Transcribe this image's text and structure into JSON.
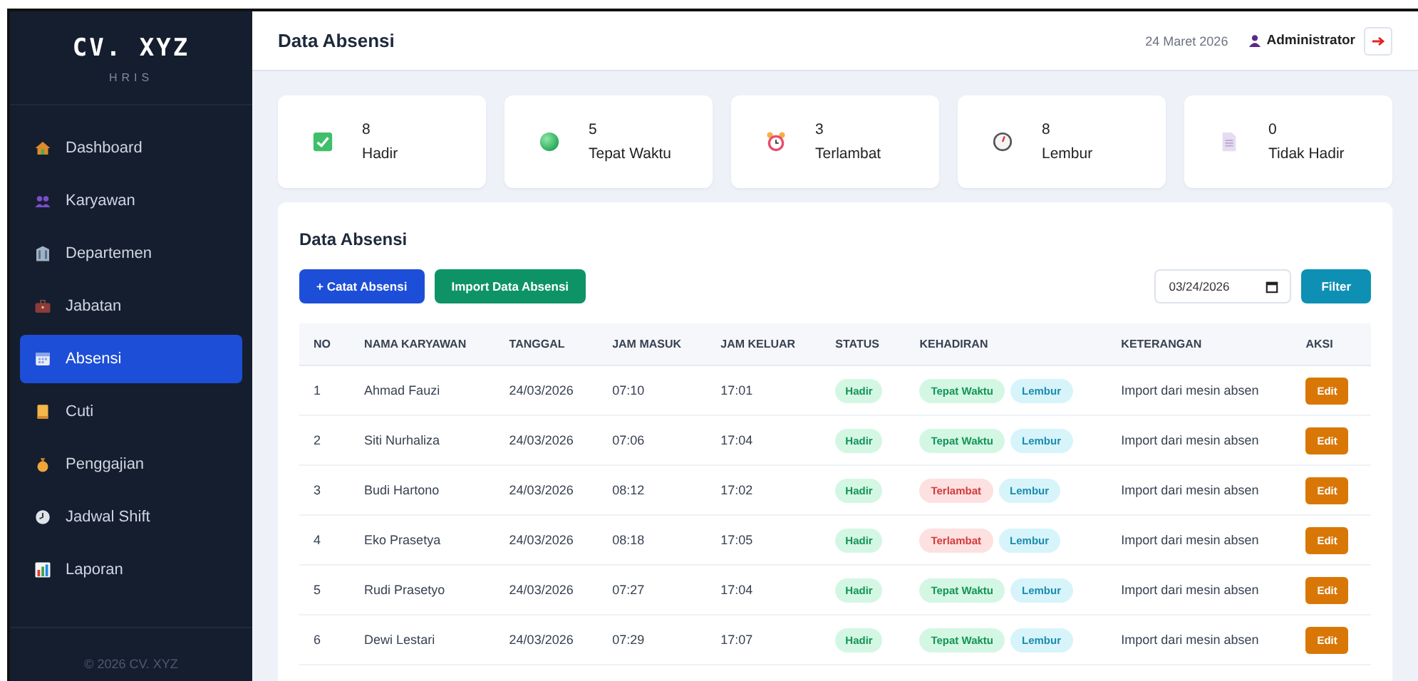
{
  "sidebar": {
    "brand": "CV. XYZ",
    "subtitle": "HRIS",
    "items": [
      {
        "label": "Dashboard",
        "kind": "house",
        "selected": false
      },
      {
        "label": "Karyawan",
        "kind": "people",
        "selected": false
      },
      {
        "label": "Departemen",
        "kind": "building",
        "selected": false
      },
      {
        "label": "Jabatan",
        "kind": "briefcase",
        "selected": false
      },
      {
        "label": "Absensi",
        "kind": "calendar",
        "selected": true
      },
      {
        "label": "Cuti",
        "kind": "scroll",
        "selected": false
      },
      {
        "label": "Penggajian",
        "kind": "moneybag",
        "selected": false
      },
      {
        "label": "Jadwal Shift",
        "kind": "clock",
        "selected": false
      },
      {
        "label": "Laporan",
        "kind": "chart",
        "selected": false
      }
    ],
    "footer": "© 2026 CV. XYZ"
  },
  "header": {
    "title": "Data Absensi",
    "date": "24 Maret 2026",
    "user": "Administrator"
  },
  "stats": [
    {
      "kind": "check",
      "value": "8",
      "label": "Hadir"
    },
    {
      "kind": "dot",
      "value": "5",
      "label": "Tepat Waktu"
    },
    {
      "kind": "alarm",
      "value": "3",
      "label": "Terlambat"
    },
    {
      "kind": "stopwatch",
      "value": "8",
      "label": "Lembur"
    },
    {
      "kind": "document",
      "value": "0",
      "label": "Tidak Hadir"
    }
  ],
  "panel": {
    "title": "Data Absensi",
    "add_button": "+ Catat Absensi",
    "import_button": "Import Data Absensi",
    "date_field": "03/24/2026",
    "filter_button": "Filter"
  },
  "table": {
    "columns": [
      "NO",
      "NAMA KARYAWAN",
      "TANGGAL",
      "JAM MASUK",
      "JAM KELUAR",
      "STATUS",
      "KEHADIRAN",
      "KETERANGAN",
      "AKSI"
    ],
    "rows": [
      {
        "no": "1",
        "name": "Ahmad Fauzi",
        "date": "24/03/2026",
        "in": "07:10",
        "out": "17:01",
        "status": "Hadir",
        "tags": [
          {
            "label": "Tepat Waktu",
            "kind": "ontime"
          },
          {
            "label": "Lembur",
            "kind": "overtime"
          }
        ],
        "note": "Import dari mesin absen",
        "action": "Edit"
      },
      {
        "no": "2",
        "name": "Siti Nurhaliza",
        "date": "24/03/2026",
        "in": "07:06",
        "out": "17:04",
        "status": "Hadir",
        "tags": [
          {
            "label": "Tepat Waktu",
            "kind": "ontime"
          },
          {
            "label": "Lembur",
            "kind": "overtime"
          }
        ],
        "note": "Import dari mesin absen",
        "action": "Edit"
      },
      {
        "no": "3",
        "name": "Budi Hartono",
        "date": "24/03/2026",
        "in": "08:12",
        "out": "17:02",
        "status": "Hadir",
        "tags": [
          {
            "label": "Terlambat",
            "kind": "late"
          },
          {
            "label": "Lembur",
            "kind": "overtime"
          }
        ],
        "note": "Import dari mesin absen",
        "action": "Edit"
      },
      {
        "no": "4",
        "name": "Eko Prasetya",
        "date": "24/03/2026",
        "in": "08:18",
        "out": "17:05",
        "status": "Hadir",
        "tags": [
          {
            "label": "Terlambat",
            "kind": "late"
          },
          {
            "label": "Lembur",
            "kind": "overtime"
          }
        ],
        "note": "Import dari mesin absen",
        "action": "Edit"
      },
      {
        "no": "5",
        "name": "Rudi Prasetyo",
        "date": "24/03/2026",
        "in": "07:27",
        "out": "17:04",
        "status": "Hadir",
        "tags": [
          {
            "label": "Tepat Waktu",
            "kind": "ontime"
          },
          {
            "label": "Lembur",
            "kind": "overtime"
          }
        ],
        "note": "Import dari mesin absen",
        "action": "Edit"
      },
      {
        "no": "6",
        "name": "Dewi Lestari",
        "date": "24/03/2026",
        "in": "07:29",
        "out": "17:07",
        "status": "Hadir",
        "tags": [
          {
            "label": "Tepat Waktu",
            "kind": "ontime"
          },
          {
            "label": "Lembur",
            "kind": "overtime"
          }
        ],
        "note": "Import dari mesin absen",
        "action": "Edit"
      }
    ]
  }
}
